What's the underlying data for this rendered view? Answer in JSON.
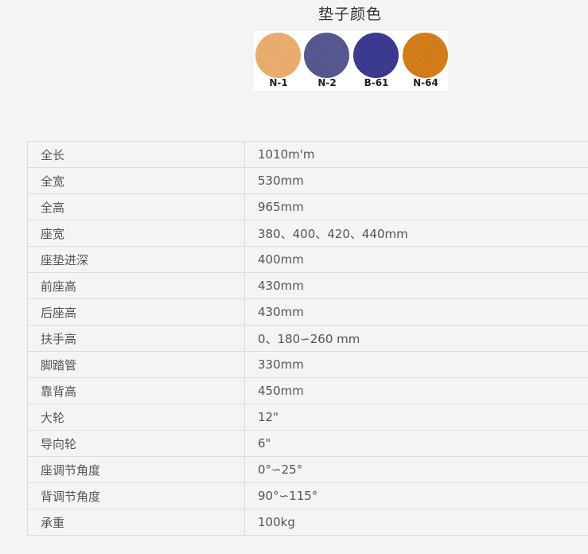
{
  "colors": {
    "title": "垫子颜色",
    "swatches": [
      {
        "code": "N-1",
        "color": "#EFAE6C"
      },
      {
        "code": "N-2",
        "color": "#52548E"
      },
      {
        "code": "B-61",
        "color": "#35348E"
      },
      {
        "code": "N-64",
        "color": "#D67B12"
      }
    ]
  },
  "specs": [
    {
      "label": "全长",
      "value": "1010m'm"
    },
    {
      "label": "全宽",
      "value": "530mm"
    },
    {
      "label": "全高",
      "value": "965mm"
    },
    {
      "label": "座宽",
      "value": "380、400、420、440mm"
    },
    {
      "label": "座垫进深",
      "value": "400mm"
    },
    {
      "label": "前座高",
      "value": "430mm"
    },
    {
      "label": "后座高",
      "value": "430mm"
    },
    {
      "label": "扶手高",
      "value": "0、180∽260 mm"
    },
    {
      "label": "脚踏管",
      "value": "330mm"
    },
    {
      "label": "靠背高",
      "value": "450mm"
    },
    {
      "label": "大轮",
      "value": "12\""
    },
    {
      "label": "导向轮",
      "value": "6\""
    },
    {
      "label": "座调节角度",
      "value": "0°∽25°"
    },
    {
      "label": "背调节角度",
      "value": "90°∽115°"
    },
    {
      "label": "承重",
      "value": "100kg"
    }
  ]
}
